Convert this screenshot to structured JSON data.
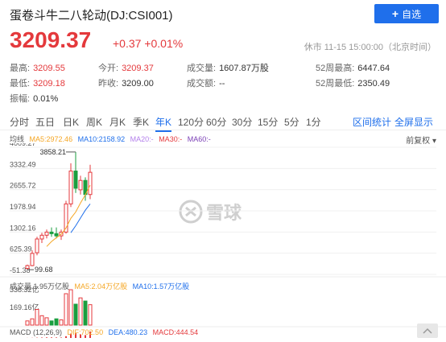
{
  "header": {
    "title": "蛋卷斗牛二八轮动(DJ:CSI001)",
    "add_label": "自选",
    "price": "3209.37",
    "change": "+0.37  +0.01%",
    "status": "休市 11-15 15:00:00（北京时间）"
  },
  "stats": {
    "high_label": "最高:",
    "high": "3209.55",
    "low_label": "最低:",
    "low": "3209.18",
    "amp_label": "振幅:",
    "amp": "0.01%",
    "open_label": "今开:",
    "open": "3209.37",
    "prev_label": "昨收:",
    "prev": "3209.00",
    "vol_label": "成交量:",
    "vol": "1607.87万股",
    "amt_label": "成交额:",
    "amt": "--",
    "w52h_label": "52周最高:",
    "w52h": "6447.64",
    "w52l_label": "52周最低:",
    "w52l": "2350.49"
  },
  "tabs": {
    "items": [
      "分时",
      "五日",
      "日K",
      "周K",
      "月K",
      "季K",
      "年K",
      "120分",
      "60分",
      "30分",
      "15分",
      "5分",
      "1分"
    ],
    "active": "年K",
    "interval_stats": "区间统计",
    "fullscreen": "全屏显示"
  },
  "legend": {
    "main": "均线",
    "ma5": "MA5:2972.46",
    "ma10": "MA10:2158.92",
    "ma20": "MA20:-",
    "ma30": "MA30:-",
    "ma60": "MA60:-",
    "fq": "前复权"
  },
  "volume": {
    "label": "成交量 1.95万亿股",
    "ma5": "MA5:2.04万亿股",
    "ma10": "MA10:1.57万亿股"
  },
  "macd": {
    "label": "MACD (12,26,9)",
    "dif": "DIF:702.50",
    "dea": "DEA:480.23",
    "macd": "MACD:444.54"
  },
  "watermark": "雪球",
  "colors": {
    "up": "#e4393c",
    "down": "#1a9e3f",
    "accent": "#1f6feb",
    "ma5": "#f5a623",
    "ma10": "#1f6feb"
  },
  "chart_data": {
    "type": "candlestick",
    "y_ticks": [
      "4009.27",
      "3332.49",
      "2655.72",
      "1978.94",
      "1302.16",
      "625.39",
      "-51.38"
    ],
    "y_range": [
      -51.38,
      4009.27
    ],
    "low_label": "99.68",
    "high_label": "3858.21",
    "candles": [
      {
        "o": 140,
        "h": 260,
        "l": 99.68,
        "c": 230
      },
      {
        "o": 230,
        "h": 720,
        "l": 210,
        "c": 620
      },
      {
        "o": 640,
        "h": 1150,
        "l": 560,
        "c": 1080
      },
      {
        "o": 1080,
        "h": 1280,
        "l": 950,
        "c": 1200
      },
      {
        "o": 1200,
        "h": 1380,
        "l": 1100,
        "c": 1300
      },
      {
        "o": 1300,
        "h": 1450,
        "l": 1150,
        "c": 1250
      },
      {
        "o": 1250,
        "h": 1450,
        "l": 1100,
        "c": 1180
      },
      {
        "o": 1180,
        "h": 1380,
        "l": 1050,
        "c": 1300
      },
      {
        "o": 1300,
        "h": 2300,
        "l": 1250,
        "c": 2200
      },
      {
        "o": 2200,
        "h": 3500,
        "l": 2100,
        "c": 3250
      },
      {
        "o": 3250,
        "h": 3858.21,
        "l": 2550,
        "c": 2700
      },
      {
        "o": 2650,
        "h": 3100,
        "l": 2500,
        "c": 2950
      },
      {
        "o": 2950,
        "h": 3050,
        "l": 2300,
        "c": 2500
      },
      {
        "o": 2500,
        "h": 3450,
        "l": 2350,
        "c": 3209.37
      }
    ],
    "ma5": [
      null,
      null,
      null,
      null,
      840,
      1000,
      1120,
      1230,
      1430,
      1740,
      1940,
      2230,
      2490,
      2800
    ],
    "ma10": [
      null,
      null,
      null,
      null,
      null,
      null,
      null,
      null,
      null,
      1280,
      1500,
      1750,
      2000,
      2200
    ],
    "vol_ticks": [
      "338.32亿",
      "169.16亿"
    ],
    "volumes": [
      40,
      60,
      150,
      90,
      70,
      40,
      60,
      50,
      300,
      338,
      200,
      260,
      230,
      195
    ],
    "macd_hist": [
      5,
      10,
      20,
      30,
      40,
      40,
      35,
      30,
      120,
      300,
      330,
      250,
      200,
      444
    ]
  }
}
